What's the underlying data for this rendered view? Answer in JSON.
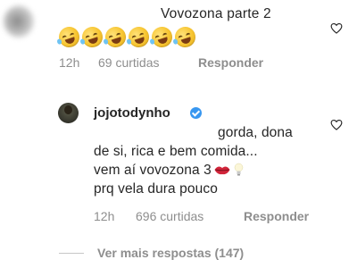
{
  "comment": {
    "text": "Vovozona parte 2",
    "emoji_icon": "rolling-on-floor-laughing-emoji",
    "emoji_count": 6,
    "time": "12h",
    "likes": "69 curtidas",
    "reply_label": "Responder",
    "like_icon": "heart-outline-icon"
  },
  "reply": {
    "username": "jojotodynho",
    "verified": true,
    "lines": [
      "gorda, dona",
      "de si, rica e bem comida...",
      "vem aí  vovozona 3",
      "prq vela dura pouco"
    ],
    "inline_icons": [
      "kiss-lips-emoji",
      "light-bulb-emoji"
    ],
    "time": "12h",
    "likes": "696 curtidas",
    "reply_label": "Responder",
    "like_icon": "heart-outline-icon"
  },
  "view_more": {
    "label": "Ver mais respostas (147)"
  },
  "colors": {
    "text": "#262626",
    "meta": "#8e8e8e",
    "verified": "#3897f0"
  }
}
